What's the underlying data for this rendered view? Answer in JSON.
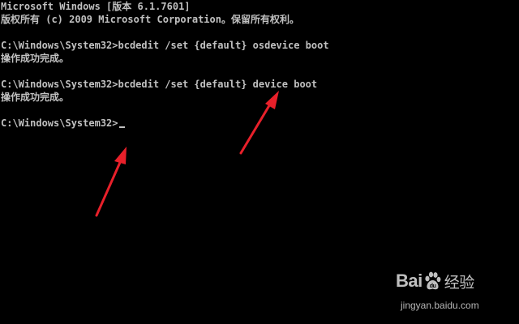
{
  "console": {
    "header_line1": "Microsoft Windows [版本 6.1.7601]",
    "header_line2": "版权所有 (c) 2009 Microsoft Corporation。保留所有权利。",
    "cmd1": "C:\\Windows\\System32>bcdedit /set {default} osdevice boot",
    "result1": "操作成功完成。",
    "cmd2": "C:\\Windows\\System32>bcdedit /set {default} device boot",
    "result2": "操作成功完成。",
    "prompt": "C:\\Windows\\System32>"
  },
  "colors": {
    "background": "#000000",
    "text": "#c0c0c0",
    "annotation_arrow": "#e8202a"
  },
  "watermark": {
    "brand_left": "Bai",
    "brand_right": "经验",
    "url": "jingyan.baidu.com"
  },
  "icons": {
    "arrow_1": "red-arrow-icon",
    "arrow_2": "red-arrow-icon",
    "paw": "baidu-paw-icon"
  }
}
